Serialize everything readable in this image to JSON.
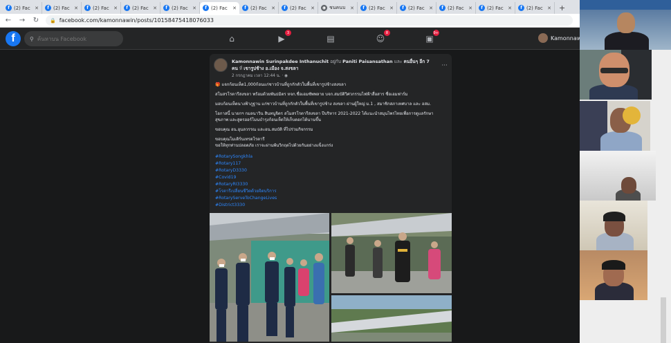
{
  "browser": {
    "tabs": [
      {
        "title": "(2) Fac",
        "icon": "facebook-icon",
        "active": false
      },
      {
        "title": "(2) Fac",
        "icon": "facebook-icon",
        "active": false
      },
      {
        "title": "(2) Fac",
        "icon": "facebook-icon",
        "active": false
      },
      {
        "title": "(2) Fac",
        "icon": "facebook-icon",
        "active": false
      },
      {
        "title": "(2) Fac",
        "icon": "facebook-icon",
        "active": false
      },
      {
        "title": "(2) Fac",
        "icon": "facebook-icon",
        "active": true
      },
      {
        "title": "(2) Fac",
        "icon": "facebook-icon",
        "active": false
      },
      {
        "title": "(2) Fac",
        "icon": "facebook-icon",
        "active": false
      },
      {
        "title": "ชนคนบ",
        "icon": "globe-icon",
        "active": false
      },
      {
        "title": "(2) Fac",
        "icon": "facebook-icon",
        "active": false
      },
      {
        "title": "(2) Fac",
        "icon": "facebook-icon",
        "active": false
      },
      {
        "title": "(2) Fac",
        "icon": "facebook-icon",
        "active": false
      },
      {
        "title": "(2) Fac",
        "icon": "facebook-icon",
        "active": false
      },
      {
        "title": "(2) Fac",
        "icon": "facebook-icon",
        "active": false
      }
    ],
    "new_tab": "+",
    "url": "facebook.com/kamonnawin/posts/10158475418076033"
  },
  "facebook": {
    "logo": "f",
    "search_placeholder": "ค้นหาบน Facebook",
    "nav_badges": {
      "watch": "3",
      "groups": "8",
      "gaming": "9+"
    },
    "user_name": "Kamonnawi"
  },
  "post": {
    "author": "Kamonnawin Surinpakdee Inthanuchit",
    "with_text": "อยู่กับ",
    "tagged": "Paniti Paisansathan",
    "and_text": "และ",
    "others": "คนอื่นๆ อีก 7 คน",
    "at_text": "ที่",
    "location": "เขารูปช้าง อ.เมือง จ.สงขลา",
    "meta": "2 กรกฎาคม เวลา 12:44 น. · ",
    "paragraphs": [
      "🎁 แจกก้อนเห็ด1,000ก้อนแก่ชาวบ้านที่ถูกกักตัวในพื้นที่เขารูปช้างสงขลา",
      "  สโมสรโรตารีสงขลา พร้อมด้วยพันธมิตร หจก.ชื่อเอมซัพพลาย บจก.สมบัติวิศวกรรมไฟฟ้าสื่อสาร ซื่อเอมฟาร์ม",
      "  มอบก้อนเห็ดนางฟ้าภูฐาน แก่ชาวบ้านที่ถูกกักตัวในพื้นที่เขารูปช้าง สงขลา ผ่านผู้ใหญ่ ม.1 , สมาชิกสภาเทศบาล และ อสม.",
      "  โอกาสนี้ นายกฯ กมลนาวิน สินทนูจิตร สโมสรโรตารีสงขลา ปีบริหาร 2021-2022 ได้แนะนำสมุนไพรไทยเพื่อการดูแลรักษาสุขภาพ และสูตรฮอร์โมนบำรุงก้อนเห็ดให้เก็บดอกได้นานขึ้น",
      "  ขอบคุณ อน.อุนลวรรณ และอน.สมบัติ ที่ไปร่วมกิจกรรม",
      "ขอบคุณโมเดิร์นเทรดโรตารี\nขอให้ทุกท่านปลอดภัย เราจะผ่านพ้นวิกฤตไปด้วยกันอย่างแข็งแกร่ง"
    ],
    "hashtags": [
      "#RotarySongkhla",
      "#Rotary117",
      "#RotaryD3330",
      "#Covid19",
      "#RotaryRI3330",
      "#โรตารีเปลี่ยนชีวิตด้วยจิตบริการ",
      "#RotaryServeToChangeLives",
      "#District3330"
    ]
  },
  "colors": {
    "fb_blue": "#1877f2",
    "link_blue": "#2d88ff",
    "bg_dark": "#18191a",
    "card_dark": "#242526",
    "badge_red": "#e41e3f"
  }
}
